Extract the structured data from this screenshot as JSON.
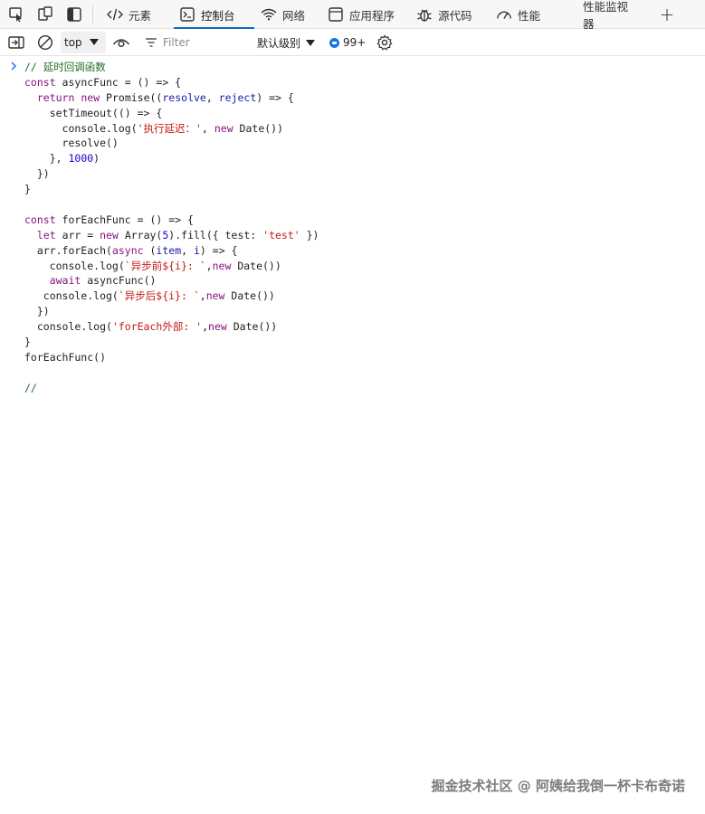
{
  "tabs": [
    {
      "label": "元素",
      "icon": "code-tag-icon"
    },
    {
      "label": "控制台",
      "icon": "console-icon",
      "active": true
    },
    {
      "label": "网络",
      "icon": "wifi-icon"
    },
    {
      "label": "应用程序",
      "icon": "application-icon"
    },
    {
      "label": "源代码",
      "icon": "bug-icon"
    },
    {
      "label": "性能",
      "icon": "performance-icon"
    },
    {
      "label": "性能监视器"
    }
  ],
  "toolbar": {
    "context": "top",
    "filter_placeholder": "Filter",
    "level": "默认级别",
    "issues_count": "99+"
  },
  "console": {
    "lines": [
      [
        {
          "t": "// 延时回调函数",
          "c": "cm"
        }
      ],
      [
        {
          "t": "const",
          "c": "kw"
        },
        {
          "t": " asyncFunc = () => {",
          "c": "op"
        }
      ],
      [
        {
          "t": "  ",
          "c": "op"
        },
        {
          "t": "return",
          "c": "kw"
        },
        {
          "t": " ",
          "c": "op"
        },
        {
          "t": "new",
          "c": "kw"
        },
        {
          "t": " Promise((",
          "c": "op"
        },
        {
          "t": "resolve",
          "c": "pa"
        },
        {
          "t": ", ",
          "c": "op"
        },
        {
          "t": "reject",
          "c": "pa"
        },
        {
          "t": ") => {",
          "c": "op"
        }
      ],
      [
        {
          "t": "    setTimeout(() => {",
          "c": "op"
        }
      ],
      [
        {
          "t": "      console.log(",
          "c": "op"
        },
        {
          "t": "'执行延迟：'",
          "c": "st"
        },
        {
          "t": ", ",
          "c": "op"
        },
        {
          "t": "new",
          "c": "kw"
        },
        {
          "t": " Date())",
          "c": "op"
        }
      ],
      [
        {
          "t": "      resolve()",
          "c": "op"
        }
      ],
      [
        {
          "t": "    }, ",
          "c": "op"
        },
        {
          "t": "1000",
          "c": "num"
        },
        {
          "t": ")",
          "c": "op"
        }
      ],
      [
        {
          "t": "  })",
          "c": "op"
        }
      ],
      [
        {
          "t": "}",
          "c": "op"
        }
      ],
      [
        {
          "t": "",
          "c": "op"
        }
      ],
      [
        {
          "t": "const",
          "c": "kw"
        },
        {
          "t": " forEachFunc = () => {",
          "c": "op"
        }
      ],
      [
        {
          "t": "  ",
          "c": "op"
        },
        {
          "t": "let",
          "c": "kw"
        },
        {
          "t": " arr = ",
          "c": "op"
        },
        {
          "t": "new",
          "c": "kw"
        },
        {
          "t": " Array(",
          "c": "op"
        },
        {
          "t": "5",
          "c": "num"
        },
        {
          "t": ").fill({ test: ",
          "c": "op"
        },
        {
          "t": "'test'",
          "c": "st"
        },
        {
          "t": " })",
          "c": "op"
        }
      ],
      [
        {
          "t": "  arr.forEach(",
          "c": "op"
        },
        {
          "t": "async",
          "c": "kw"
        },
        {
          "t": " (",
          "c": "op"
        },
        {
          "t": "item",
          "c": "pa"
        },
        {
          "t": ", ",
          "c": "op"
        },
        {
          "t": "i",
          "c": "pa"
        },
        {
          "t": ") => {",
          "c": "op"
        }
      ],
      [
        {
          "t": "    console.log(",
          "c": "op"
        },
        {
          "t": "`异步前${i}: `",
          "c": "st"
        },
        {
          "t": ",",
          "c": "op"
        },
        {
          "t": "new",
          "c": "kw"
        },
        {
          "t": " Date())",
          "c": "op"
        }
      ],
      [
        {
          "t": "    ",
          "c": "op"
        },
        {
          "t": "await",
          "c": "kw"
        },
        {
          "t": " asyncFunc()",
          "c": "op"
        }
      ],
      [
        {
          "t": "   console.log(",
          "c": "op"
        },
        {
          "t": "`异步后${i}: `",
          "c": "st"
        },
        {
          "t": ",",
          "c": "op"
        },
        {
          "t": "new",
          "c": "kw"
        },
        {
          "t": " Date())",
          "c": "op"
        }
      ],
      [
        {
          "t": "  })",
          "c": "op"
        }
      ],
      [
        {
          "t": "  console.log(",
          "c": "op"
        },
        {
          "t": "'forEach外部: '",
          "c": "st"
        },
        {
          "t": ",",
          "c": "op"
        },
        {
          "t": "new",
          "c": "kw"
        },
        {
          "t": " Date())",
          "c": "op"
        }
      ],
      [
        {
          "t": "}",
          "c": "op"
        }
      ],
      [
        {
          "t": "forEachFunc()",
          "c": "op"
        }
      ],
      [
        {
          "t": "",
          "c": "op"
        }
      ],
      [
        {
          "t": "//",
          "c": "cm"
        }
      ]
    ]
  },
  "watermark": "掘金技术社区 @ 阿姨给我倒一杯卡布奇诺"
}
